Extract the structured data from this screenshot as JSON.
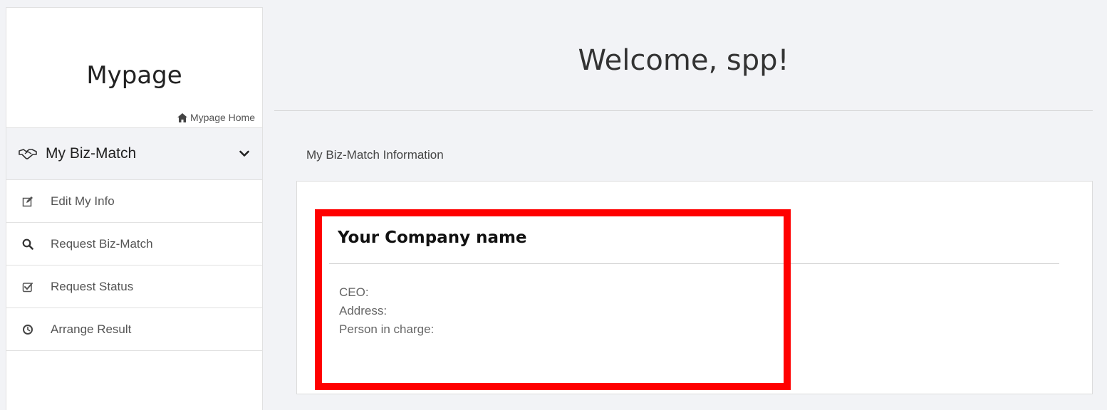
{
  "sidebar": {
    "title": "Mypage",
    "home_link": "Mypage Home",
    "section": {
      "label": "My Biz-Match",
      "icon": "handshake-icon",
      "expand_icon": "chevron-down-icon"
    },
    "items": [
      {
        "label": "Edit My Info",
        "icon": "edit-icon"
      },
      {
        "label": "Request Biz-Match",
        "icon": "search-icon"
      },
      {
        "label": "Request Status",
        "icon": "checkbox-icon"
      },
      {
        "label": "Arrange Result",
        "icon": "clock-icon"
      }
    ]
  },
  "main": {
    "welcome": "Welcome, spp!",
    "section_title": "My Biz-Match Information",
    "company": {
      "name": "Your Company name",
      "ceo": "CEO: ",
      "address": "Address: ",
      "person_in_charge": "Person in charge: "
    }
  },
  "colors": {
    "highlight": "#ff0000",
    "page_bg": "#f2f3f6",
    "panel_bg": "#ffffff"
  }
}
